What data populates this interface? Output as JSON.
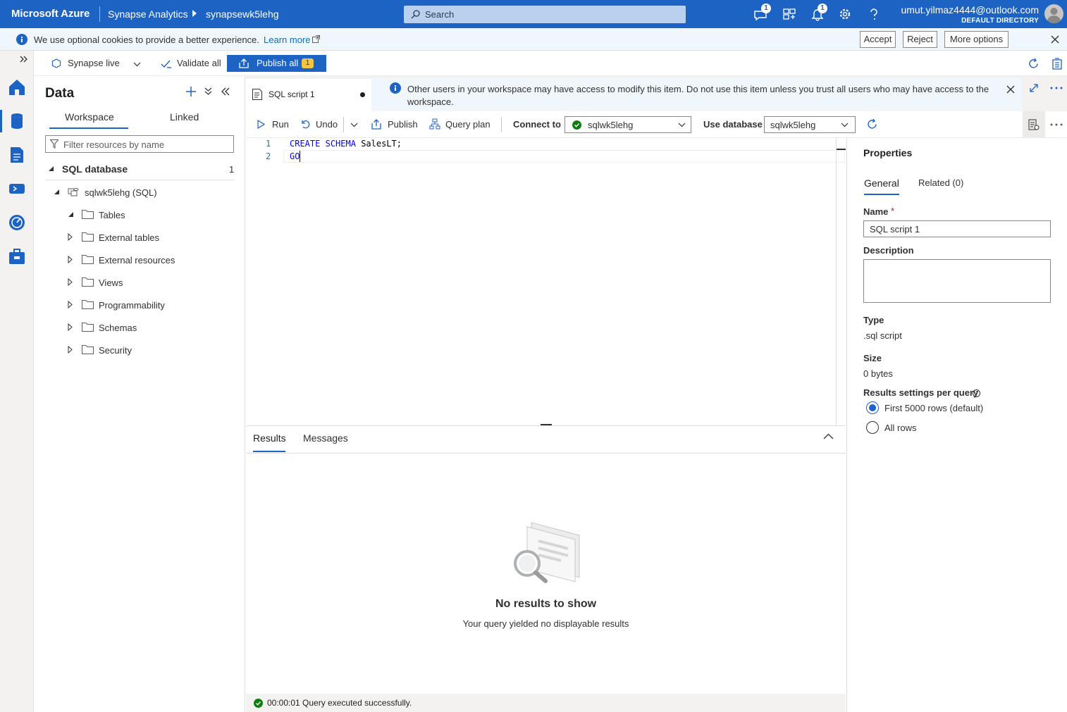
{
  "topbar": {
    "brand": "Microsoft Azure",
    "product": "Synapse Analytics",
    "workspace": "synapsewk5lehg",
    "search_placeholder": "Search",
    "feedback_badge": "1",
    "notif_badge": "1",
    "user_email": "umut.yilmaz4444@outlook.com",
    "user_directory": "DEFAULT DIRECTORY"
  },
  "cookie_bar": {
    "message": "We use optional cookies to provide a better experience.",
    "learn_more": "Learn more",
    "accept": "Accept",
    "reject": "Reject",
    "more_options": "More options"
  },
  "toolbar": {
    "mode": "Synapse live",
    "validate_all": "Validate all",
    "publish_all": "Publish all",
    "publish_count": "1"
  },
  "data_panel": {
    "title": "Data",
    "tabs": [
      "Workspace",
      "Linked"
    ],
    "filter_placeholder": "Filter resources by name",
    "section": "SQL database",
    "section_count": "1",
    "database": "sqlwk5lehg (SQL)",
    "folders": [
      "Tables",
      "External tables",
      "External resources",
      "Views",
      "Programmability",
      "Schemas",
      "Security"
    ]
  },
  "editor": {
    "tab_label": "SQL script 1",
    "notice": "Other users in your workspace may have access to modify this item. Do not use this item unless you trust all users who may have access to the workspace.",
    "run": "Run",
    "undo": "Undo",
    "publish": "Publish",
    "query_plan": "Query plan",
    "connect_to_label": "Connect to",
    "connect_to_value": "sqlwk5lehg",
    "use_database_label": "Use database",
    "use_database_value": "sqlwk5lehg",
    "lines": [
      {
        "num": "1",
        "kw1": "CREATE",
        "kw2": "SCHEMA",
        "rest": "SalesLT;"
      },
      {
        "num": "2",
        "kw1": "GO",
        "kw2": "",
        "rest": ""
      }
    ]
  },
  "results": {
    "tabs": [
      "Results",
      "Messages"
    ],
    "empty_title": "No results to show",
    "empty_sub": "Your query yielded no displayable results",
    "status": "00:00:01 Query executed successfully."
  },
  "properties": {
    "title": "Properties",
    "tab_general": "General",
    "tab_related": "Related (0)",
    "name_label": "Name",
    "name_required": "*",
    "name_value": "SQL script 1",
    "description_label": "Description",
    "type_label": "Type",
    "type_value": ".sql script",
    "size_label": "Size",
    "size_value": "0 bytes",
    "results_settings_label": "Results settings per query",
    "option_first": "First 5000 rows (default)",
    "option_all": "All rows"
  },
  "colors": {
    "azure_blue": "#1d63c4",
    "success_green": "#107c10",
    "info_blue": "#0f6cbd"
  }
}
